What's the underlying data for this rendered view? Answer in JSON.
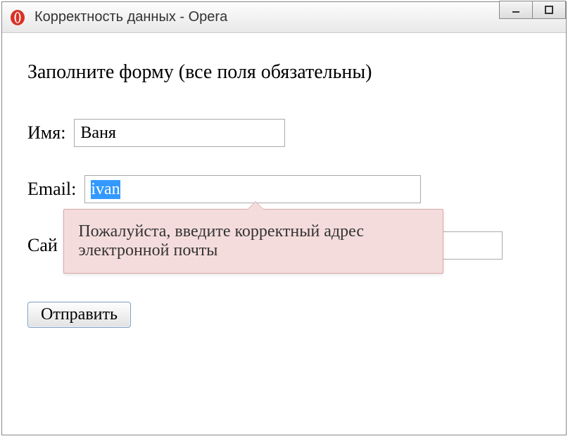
{
  "window": {
    "title": "Корректность данных - Opera"
  },
  "page": {
    "heading": "Заполните форму (все поля обязательны)"
  },
  "form": {
    "name": {
      "label": "Имя:",
      "value": "Ваня"
    },
    "email": {
      "label": "Email:",
      "value": "ivan",
      "tooltip": "Пожалуйста, введите корректный адрес электронной почты"
    },
    "site": {
      "label": "Сай",
      "value": ""
    },
    "submit": {
      "label": "Отправить"
    }
  }
}
